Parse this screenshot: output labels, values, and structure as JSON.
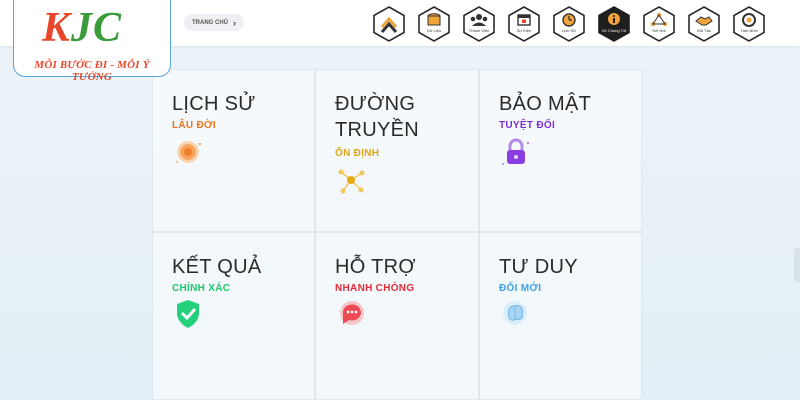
{
  "logo": {
    "text_k": "K",
    "text_jc": "JC",
    "slogan": "MỖI BƯỚC ĐI - MỖI Ý TƯỞNG"
  },
  "breadcrumb": {
    "home": "TRANG CHỦ",
    "chevron": "›"
  },
  "nav": [
    {
      "label": "",
      "icon": "home-chevron-icon"
    },
    {
      "label": "Dữ Liệu",
      "icon": "database-icon"
    },
    {
      "label": "Thành Viên",
      "icon": "members-icon"
    },
    {
      "label": "Sự Kiện",
      "icon": "calendar-icon"
    },
    {
      "label": "Lịch Sử",
      "icon": "clock-icon"
    },
    {
      "label": "Về Chúng Tôi",
      "icon": "info-icon"
    },
    {
      "label": "Kết Nối",
      "icon": "network-icon"
    },
    {
      "label": "Đối Tác",
      "icon": "handshake-icon"
    },
    {
      "label": "Tầm Nhìn",
      "icon": "target-icon"
    }
  ],
  "cards": [
    {
      "title": "LỊCH SỬ",
      "subtitle": "LÂU ĐỜI",
      "color": "#e8741e",
      "icon": "sun-globe-icon"
    },
    {
      "title": "ĐƯỜNG TRUYỀN",
      "subtitle": "ỔN ĐỊNH",
      "color": "#e0a415",
      "icon": "connection-nodes-icon"
    },
    {
      "title": "BẢO MẬT",
      "subtitle": "TUYỆT ĐỐI",
      "color": "#7b2fd6",
      "icon": "padlock-icon"
    },
    {
      "title": "KẾT QUẢ",
      "subtitle": "CHÍNH XÁC",
      "color": "#1ec76a",
      "icon": "shield-check-icon"
    },
    {
      "title": "HỖ TRỢ",
      "subtitle": "NHANH CHÓNG",
      "color": "#e52b3a",
      "icon": "chat-bubble-icon"
    },
    {
      "title": "TƯ DUY",
      "subtitle": "ĐỔI MỚI",
      "color": "#3aa0e8",
      "icon": "brain-icon"
    }
  ]
}
